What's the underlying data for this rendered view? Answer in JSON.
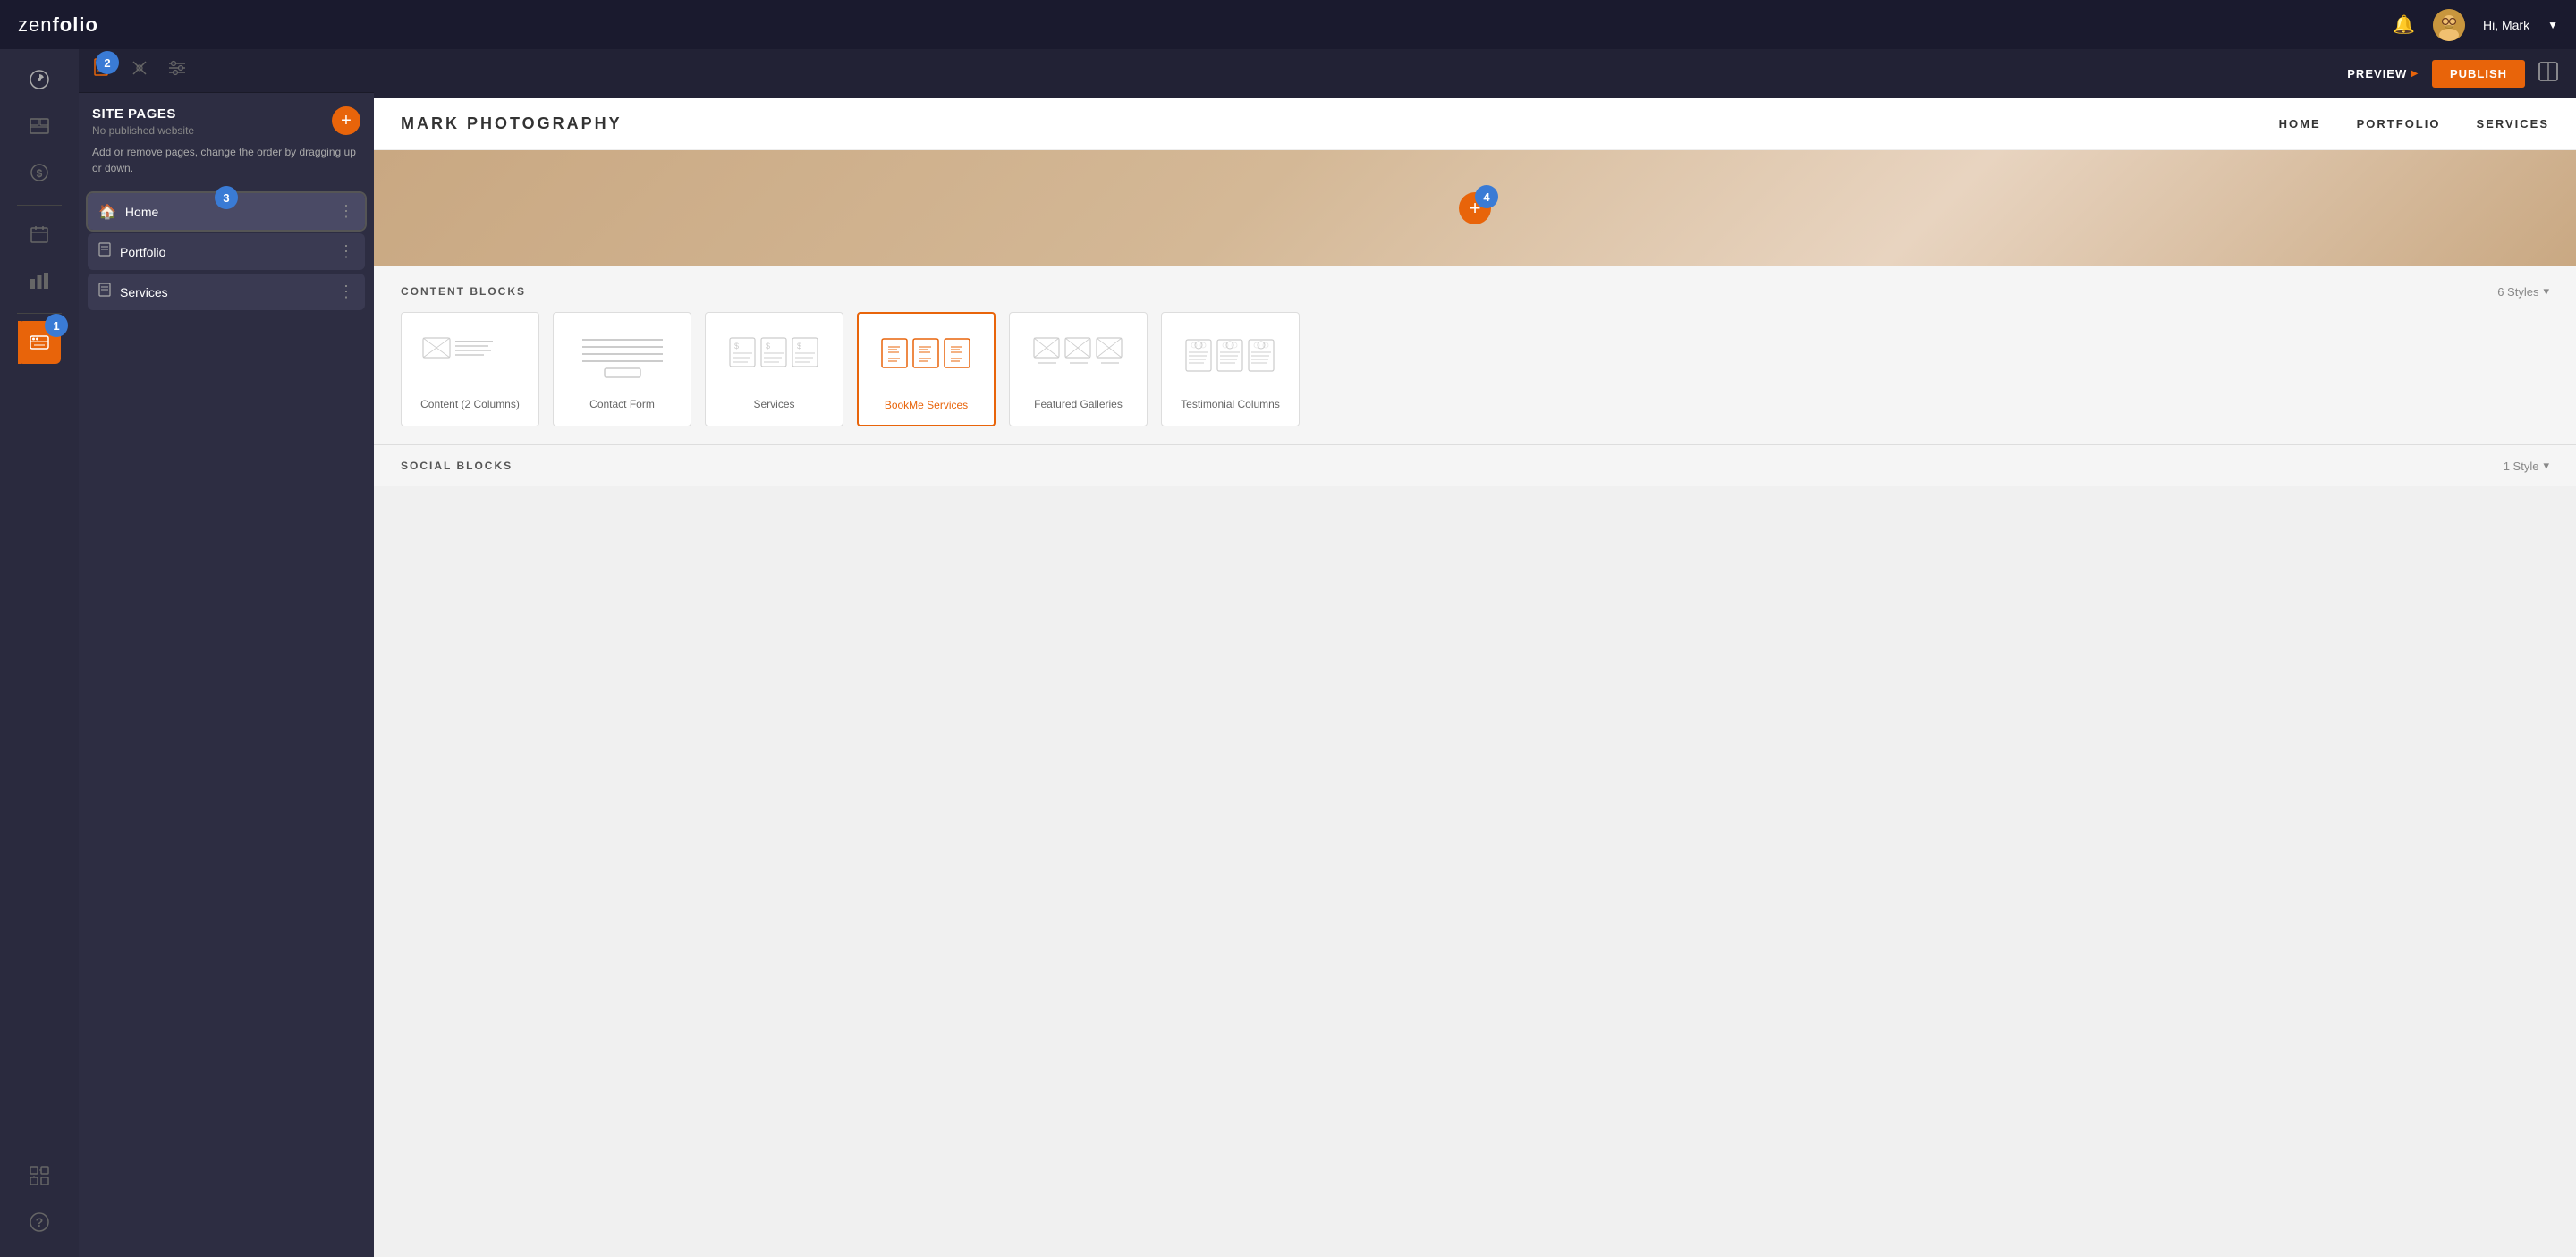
{
  "header": {
    "logo": "zenfolio",
    "bell_label": "🔔",
    "user_greeting": "Hi, Mark",
    "avatar_emoji": "👨"
  },
  "top_toolbar": {
    "preview_label": "PREVIEW",
    "publish_label": "PUBLISH"
  },
  "sidebar": {
    "icons": [
      {
        "name": "dashboard",
        "glyph": "⊞",
        "active": false
      },
      {
        "name": "gallery",
        "glyph": "🖼",
        "active": false
      },
      {
        "name": "pricing",
        "glyph": "$",
        "active": false
      },
      {
        "name": "calendar",
        "glyph": "📅",
        "active": false
      },
      {
        "name": "analytics",
        "glyph": "📊",
        "active": false
      },
      {
        "name": "website-builder",
        "glyph": "🌐",
        "active": true,
        "highlight": true
      },
      {
        "name": "integrations",
        "glyph": "⊞+",
        "active": false
      },
      {
        "name": "help",
        "glyph": "?",
        "active": false
      }
    ]
  },
  "panel": {
    "toolbar": {
      "pages_icon": "📋",
      "tools_icon": "🔧",
      "settings_icon": "⚙"
    },
    "title": "SITE PAGES",
    "subtitle": "No published website",
    "description": "Add or remove pages, change the order by dragging up or down.",
    "add_label": "+",
    "pages": [
      {
        "name": "Home",
        "icon": "🏠",
        "active": true
      },
      {
        "name": "Portfolio",
        "icon": "📄",
        "active": false
      },
      {
        "name": "Services",
        "icon": "📄",
        "active": false
      }
    ]
  },
  "mockup": {
    "logo": "MARK PHOTOGRAPHY",
    "nav_links": [
      "HOME",
      "PORTFOLIO",
      "SERVICES"
    ]
  },
  "content_blocks": {
    "title": "CONTENT BLOCKS",
    "styles_label": "6 Styles",
    "blocks": [
      {
        "id": "content-2col",
        "label": "Content (2 Columns)",
        "selected": false
      },
      {
        "id": "contact-form",
        "label": "Contact Form",
        "selected": false
      },
      {
        "id": "services",
        "label": "Services",
        "selected": false
      },
      {
        "id": "bookme-services",
        "label": "BookMe Services",
        "selected": true
      },
      {
        "id": "featured-galleries",
        "label": "Featured Galleries",
        "selected": false
      },
      {
        "id": "testimonial-columns",
        "label": "Testimonial Columns",
        "selected": false
      }
    ]
  },
  "social_blocks": {
    "title": "SOCIAL BLOCKS",
    "styles_label": "1 Style"
  },
  "badges": {
    "b1": "1",
    "b2": "2",
    "b3": "3",
    "b4": "4"
  }
}
